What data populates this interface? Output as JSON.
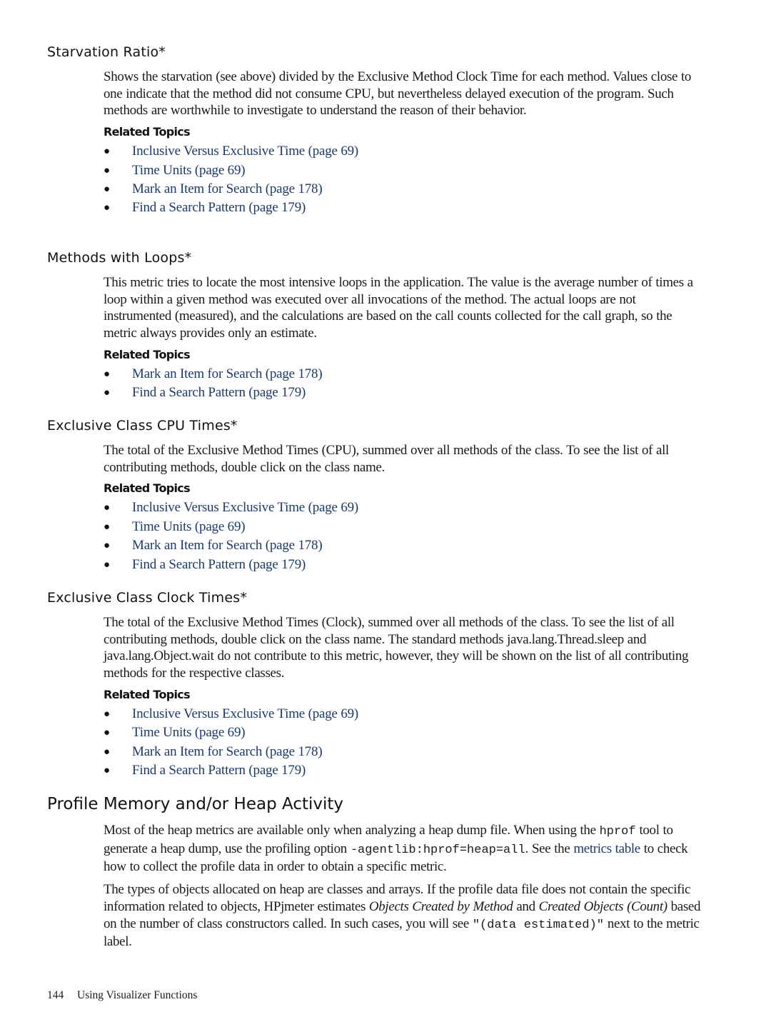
{
  "sections": [
    {
      "heading": "Starvation Ratio*",
      "paragraph": "Shows the starvation (see above) divided by the Exclusive Method Clock Time for each method. Values close to one indicate that the method did not consume CPU, but nevertheless delayed execution of the program. Such methods are worthwhile to investigate to understand the reason of their behavior.",
      "related_label": "Related Topics",
      "topics": [
        "Inclusive Versus Exclusive Time (page 69)",
        "Time Units (page 69)",
        "Mark an Item for Search (page 178)",
        "Find a Search Pattern (page 179)"
      ]
    },
    {
      "heading": "Methods with Loops*",
      "paragraph": "This metric tries to locate the most intensive loops in the application. The value is the average number of times a loop within a given method was executed over all invocations of the method. The actual loops are not instrumented (measured), and the calculations are based on the call counts collected for the call graph, so the metric always provides only an estimate.",
      "related_label": "Related Topics",
      "topics": [
        "Mark an Item for Search (page 178)",
        "Find a Search Pattern (page 179)"
      ]
    },
    {
      "heading": "Exclusive Class CPU Times*",
      "paragraph": "The total of the Exclusive Method Times (CPU), summed over all methods of the class. To see the list of all contributing methods, double click on the class name.",
      "related_label": "Related Topics",
      "topics": [
        "Inclusive Versus Exclusive Time (page 69)",
        "Time Units (page 69)",
        "Mark an Item for Search (page 178)",
        "Find a Search Pattern (page 179)"
      ]
    },
    {
      "heading": "Exclusive Class Clock Times*",
      "paragraph": "The total of the Exclusive Method Times (Clock), summed over all methods of the class. To see the list of all contributing methods, double click on the class name. The standard methods java.lang.Thread.sleep and java.lang.Object.wait do not contribute to this metric, however, they will be shown on the list of all contributing methods for the respective classes.",
      "related_label": "Related Topics",
      "topics": [
        "Inclusive Versus Exclusive Time (page 69)",
        "Time Units (page 69)",
        "Mark an Item for Search (page 178)",
        "Find a Search Pattern (page 179)"
      ]
    }
  ],
  "heap_section": {
    "heading": "Profile Memory and/or Heap Activity",
    "p1": {
      "t1": "Most of the heap metrics are available only when analyzing a heap dump file. When using the ",
      "code1": "hprof",
      "t2": " tool to generate a heap dump, use the profiling option ",
      "code2": "-agentlib:hprof=heap=all",
      "t3": ". See the ",
      "link": "metrics table",
      "t4": " to check how to collect the profile data in order to obtain a specific metric."
    },
    "p2": {
      "t1": "The types of objects allocated on heap are classes and arrays. If the profile data file does not contain the specific information related to objects, HPjmeter estimates ",
      "em1": "Objects Created by Method",
      "t2": " and ",
      "em2": "Created Objects (Count)",
      "t3": " based on the number of class constructors called. In such cases, you will see ",
      "code": "\"(data estimated)\"",
      "t4": " next to the metric label."
    }
  },
  "footer": {
    "page_number": "144",
    "chapter": "Using Visualizer Functions"
  },
  "colors": {
    "link": "#1b3a6b",
    "text": "#1a1a1a"
  }
}
